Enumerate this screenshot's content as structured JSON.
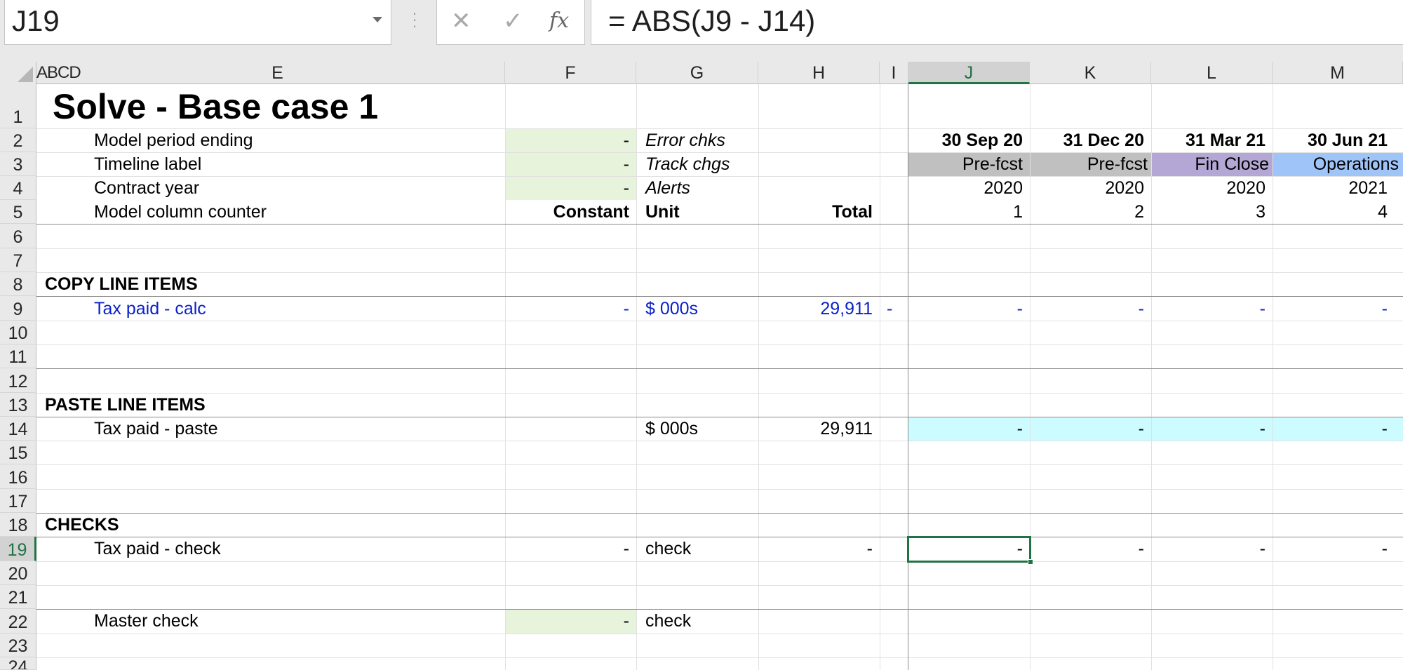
{
  "formula_bar": {
    "name_box": "J19",
    "cancel_icon": "✕",
    "enter_icon": "✓",
    "fx_label": "fx",
    "formula": "= ABS(J9 - J14)"
  },
  "columns": [
    "ABCD",
    "E",
    "F",
    "G",
    "H",
    "I",
    "J",
    "K",
    "L",
    "M"
  ],
  "active_column": "J",
  "rows": [
    "1",
    "2",
    "3",
    "4",
    "5",
    "6",
    "7",
    "8",
    "9",
    "10",
    "11",
    "12",
    "13",
    "14",
    "15",
    "16",
    "17",
    "18",
    "19",
    "20",
    "21",
    "22",
    "23",
    "24"
  ],
  "active_row": "19",
  "sheet": {
    "title": "Solve - Base case 1",
    "header_labels": {
      "model_period_ending": "Model period ending",
      "timeline_label": "Timeline label",
      "contract_year": "Contract year",
      "model_column_counter": "Model column counter"
    },
    "header_f": {
      "r2": "-",
      "r3": "-",
      "r4": "-",
      "r5": "Constant"
    },
    "header_g": {
      "r2": "Error chks",
      "r3": "Track chgs",
      "r4": "Alerts",
      "r5": "Unit"
    },
    "header_h": {
      "r5": "Total"
    },
    "timeline": {
      "dates": [
        "30 Sep 20",
        "31 Dec 20",
        "31 Mar 21",
        "30 Jun 21"
      ],
      "labels": [
        "Pre-fcst",
        "Pre-fcst",
        "Fin Close",
        "Operations"
      ],
      "years": [
        "2020",
        "2020",
        "2020",
        "2021"
      ],
      "counters": [
        "1",
        "2",
        "3",
        "4"
      ]
    },
    "sections": {
      "copy": "COPY LINE ITEMS",
      "paste": "PASTE LINE ITEMS",
      "checks": "CHECKS"
    },
    "tax_calc": {
      "label": "Tax paid - calc",
      "constant": "-",
      "unit": "$ 000s",
      "total": "29,911",
      "i": "-",
      "values": [
        "-",
        "-",
        "-",
        "-"
      ]
    },
    "tax_paste": {
      "label": "Tax paid - paste",
      "unit": "$ 000s",
      "total": "29,911",
      "values": [
        "-",
        "-",
        "-",
        "-"
      ]
    },
    "tax_check": {
      "label": "Tax paid - check",
      "constant": "-",
      "unit": "check",
      "total": "-",
      "values": [
        "-",
        "-",
        "-",
        "-"
      ]
    },
    "master_check": {
      "label": "Master check",
      "constant": "-",
      "unit": "check"
    }
  },
  "colors": {
    "input_green": "#e8f3dc",
    "prefcst_gray": "#c0c0c0",
    "finclose_purple": "#b4a7d6",
    "operations_blue": "#9fc5f8",
    "paste_cyan": "#ccfcff",
    "selection_green": "#217346",
    "link_blue": "#0b22c9"
  }
}
